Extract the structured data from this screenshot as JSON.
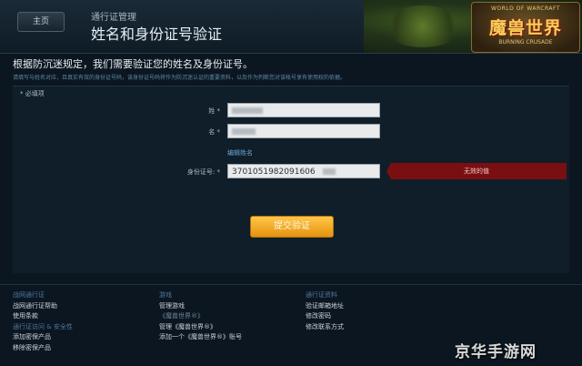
{
  "header": {
    "home_label": "主页",
    "subtitle": "通行证管理",
    "title": "姓名和身份证号验证"
  },
  "banner": {
    "logo_main": "魔兽世界",
    "logo_small": "WORLD OF WARCRAFT",
    "logo_sub": "BURNING CRUSADE"
  },
  "intro": {
    "text": "根据防沉迷规定，我们需要验证您的姓名及身份证号。",
    "note": "请填写与姓名对应，且真实有效的身份证号码，该身份证号码将作为防沉迷认证的重要资料，以及作为判断您对该帐号享有使用权的依据。"
  },
  "form": {
    "required_label": "* 必填项",
    "surname_label": "姓 *",
    "name_label": "名 *",
    "edit_name_link": "编辑姓名",
    "id_label": "身份证号: *",
    "id_value": "3701051982091606",
    "error_text": "无效的值",
    "submit_label": "提交验证"
  },
  "footer": {
    "col1": {
      "head1": "战网通行证",
      "items1": [
        "战网通行证帮助",
        "使用条款"
      ],
      "head2": "通行证访问 & 安全性",
      "items2": [
        "添加密保产品",
        "移除密保产品"
      ]
    },
    "col2": {
      "head1": "游戏",
      "items1": [
        "管理游戏"
      ],
      "dim": "《魔兽世界®》",
      "items2": [
        "管理《魔兽世界®》",
        "添加一个《魔兽世界®》账号"
      ]
    },
    "col3": {
      "head1": "通行证资料",
      "items1": [
        "验证邮箱地址",
        "修改密码",
        "修改联系方式"
      ]
    }
  },
  "watermark": "京华手游网"
}
